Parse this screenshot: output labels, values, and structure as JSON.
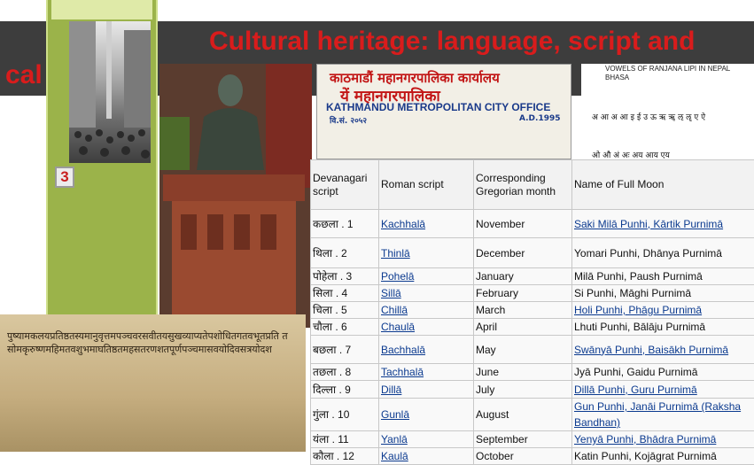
{
  "slide": {
    "title_line1": "Cultural heritage: language, script and",
    "title_line2": "cal",
    "badge": "3",
    "colors": {
      "title": "#d91c1c",
      "titlebar": "#3d3d3d",
      "strip": "#9bb34a",
      "link": "#0b3a8f"
    }
  },
  "sign": {
    "line1": "काठमाडौं महानगरपालिका कार्यालय",
    "line2": "यें महानगरपालिका",
    "line3": "KATHMANDU METROPOLITAN CITY OFFICE",
    "line4": "वि.सं. २०५२",
    "line5": "A.D.1995"
  },
  "vowels": {
    "title": "Vowels of Ranjana Lipi in Nepal Bhasa",
    "row1": "अ आ अ आ इ ई उ ऊ ऋ ॠ ऌ ॡ ए ऐ",
    "row2": "ओ औ अं अः अय आय एय"
  },
  "manuscript": {
    "text": "पुष्यामकलयप्रतिष्ठतस्यमानुवृत्तमपञ्चवरसवीतयसुखव्याप्यतेपशोधितगतवभूतप्रति तसोमकृरुष्णमहिमतवशुभमाघतिष्ठतमहसतरणशतपूर्णपञ्चमासवयोदिवसत्रयोदश"
  },
  "table": {
    "headers": [
      "Devanagari script",
      "Roman script",
      "Corresponding Gregorian month",
      "Name of Full Moon"
    ],
    "rows": [
      {
        "dev": "कछला",
        "idx": ". 1",
        "roman": "Kachhalā",
        "month": "November",
        "moon": "Saki Milā Punhi, Kārtik Purnimā",
        "moon_link": true
      },
      {
        "dev": "थिला",
        "idx": ". 2",
        "roman": "Thinlā",
        "month": "December",
        "moon": "Yomari Punhi, Dhānya Purnimā",
        "moon_link": false
      },
      {
        "dev": "पोहेला",
        "idx": ". 3",
        "roman": "Pohelā",
        "month": "January",
        "moon": "Milā Punhi, Paush Purnimā",
        "moon_link": false
      },
      {
        "dev": "सिला",
        "idx": ". 4",
        "roman": "Sillā",
        "month": "February",
        "moon": "Si Punhi, Māghi Purnimā",
        "moon_link": false
      },
      {
        "dev": "चिला",
        "idx": ". 5",
        "roman": "Chillā",
        "month": "March",
        "moon": "Holi Punhi, Phāgu Purnimā",
        "moon_link": true
      },
      {
        "dev": "चौला",
        "idx": ". 6",
        "roman": "Chaulā",
        "month": "April",
        "moon": "Lhuti Punhi, Bālāju Purnimā",
        "moon_link": false
      },
      {
        "dev": "बछला",
        "idx": ". 7",
        "roman": "Bachhalā",
        "month": "May",
        "moon": "Swānyā Punhi, Baisākh Purnimā",
        "moon_link": true
      },
      {
        "dev": "तछला",
        "idx": ". 8",
        "roman": "Tachhalā",
        "month": "June",
        "moon": "Jyā Punhi, Gaidu Purnimā",
        "moon_link": false
      },
      {
        "dev": "दिल्ला",
        "idx": ". 9",
        "roman": "Dillā",
        "month": "July",
        "moon": "Dillā Punhi, Guru Purnimā",
        "moon_link": true
      },
      {
        "dev": "गुंला",
        "idx": ". 10",
        "roman": "Gunlā",
        "month": "August",
        "moon": "Gun Punhi, Janāi Purnimā (Raksha Bandhan)",
        "moon_link": true
      },
      {
        "dev": "यंला",
        "idx": ". 11",
        "roman": "Yanlā",
        "month": "September",
        "moon": "Yenyā Punhi, Bhādra Purnimā",
        "moon_link": true
      },
      {
        "dev": "कौला",
        "idx": ". 12",
        "roman": "Kaulā",
        "month": "October",
        "moon": "Katin Punhi, Kojāgrat Purnimā",
        "moon_link": false
      }
    ]
  }
}
